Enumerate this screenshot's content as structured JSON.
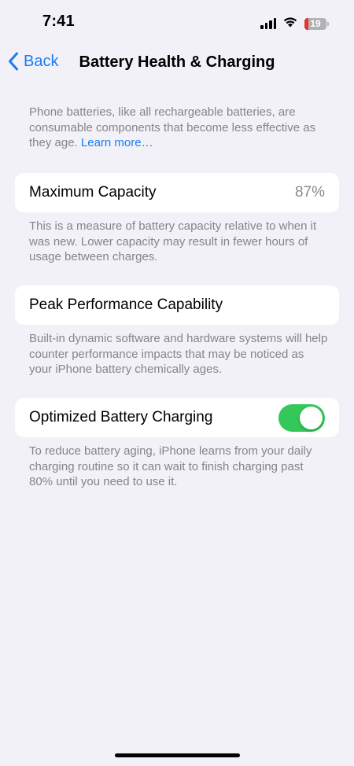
{
  "status_bar": {
    "time": "7:41",
    "battery_level": "19",
    "battery_fraction": 0.19,
    "battery_color": "#e5382d",
    "icons": [
      "cellular-signal-icon",
      "wifi-icon",
      "battery-icon"
    ]
  },
  "nav": {
    "back_label": "Back",
    "title": "Battery Health & Charging",
    "accent_color": "#1a7cf5"
  },
  "intro": {
    "text": "Phone batteries, like all rechargeable batteries, are consumable components that become less effective as they age. ",
    "link": "Learn more…"
  },
  "maximum_capacity": {
    "label": "Maximum Capacity",
    "value": "87%",
    "footnote": "This is a measure of battery capacity relative to when it was new. Lower capacity may result in fewer hours of usage between charges."
  },
  "peak_performance": {
    "label": "Peak Performance Capability",
    "footnote": "Built-in dynamic software and hardware systems will help counter performance impacts that may be noticed as your iPhone battery chemically ages."
  },
  "optimized_charging": {
    "label": "Optimized Battery Charging",
    "enabled": true,
    "toggle_color": "#34c759",
    "footnote": "To reduce battery aging, iPhone learns from your daily charging routine so it can wait to finish charging past 80% until you need to use it."
  }
}
